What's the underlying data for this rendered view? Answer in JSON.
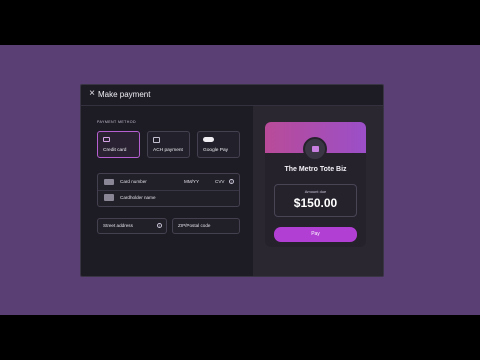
{
  "modal": {
    "close_symbol": "×",
    "title": "Make payment"
  },
  "payment_method": {
    "section_label": "PAYMENT METHOD",
    "options": [
      {
        "label": "Credit card",
        "icon": "credit-card-icon",
        "selected": true
      },
      {
        "label": "ACH payment",
        "icon": "bank-icon",
        "selected": false
      },
      {
        "label": "Google Pay",
        "icon": "google-pay-icon",
        "selected": false
      }
    ]
  },
  "card_fields": {
    "card_number_placeholder": "Card number",
    "expiry_placeholder": "MM/YY",
    "cvv_placeholder": "CVV",
    "cardholder_placeholder": "Cardholder name"
  },
  "address_fields": {
    "street_placeholder": "Street address",
    "zip_placeholder": "ZIP/Postal code"
  },
  "summary": {
    "business_name": "The Metro Tote Biz",
    "amount_label": "Amount due",
    "amount_value": "$150.00",
    "pay_label": "Pay"
  },
  "colors": {
    "accent": "#b23fd4",
    "banner_start": "#b94b98",
    "banner_end": "#9b4fc8",
    "background": "#5a3f75"
  }
}
